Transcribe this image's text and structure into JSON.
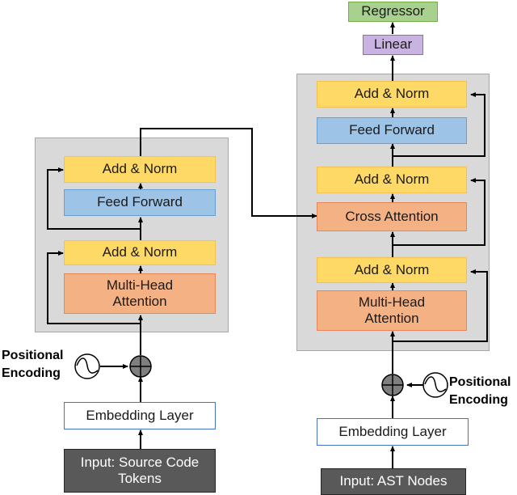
{
  "encoder": {
    "add_norm_top": "Add & Norm",
    "feed_forward": "Feed Forward",
    "add_norm_bottom": "Add & Norm",
    "attention": "Multi-Head Attention",
    "positional_encoding": "Positional Encoding",
    "embedding": "Embedding Layer",
    "input": "Input: Source Code Tokens"
  },
  "decoder": {
    "regressor": "Regressor",
    "linear": "Linear",
    "add_norm_top": "Add & Norm",
    "feed_forward": "Feed Forward",
    "add_norm_mid": "Add & Norm",
    "cross_attention": "Cross Attention",
    "add_norm_bottom": "Add & Norm",
    "attention": "Multi-Head Attention",
    "positional_encoding": "Positional Encoding",
    "embedding": "Embedding Layer",
    "input": "Input: AST Nodes"
  }
}
